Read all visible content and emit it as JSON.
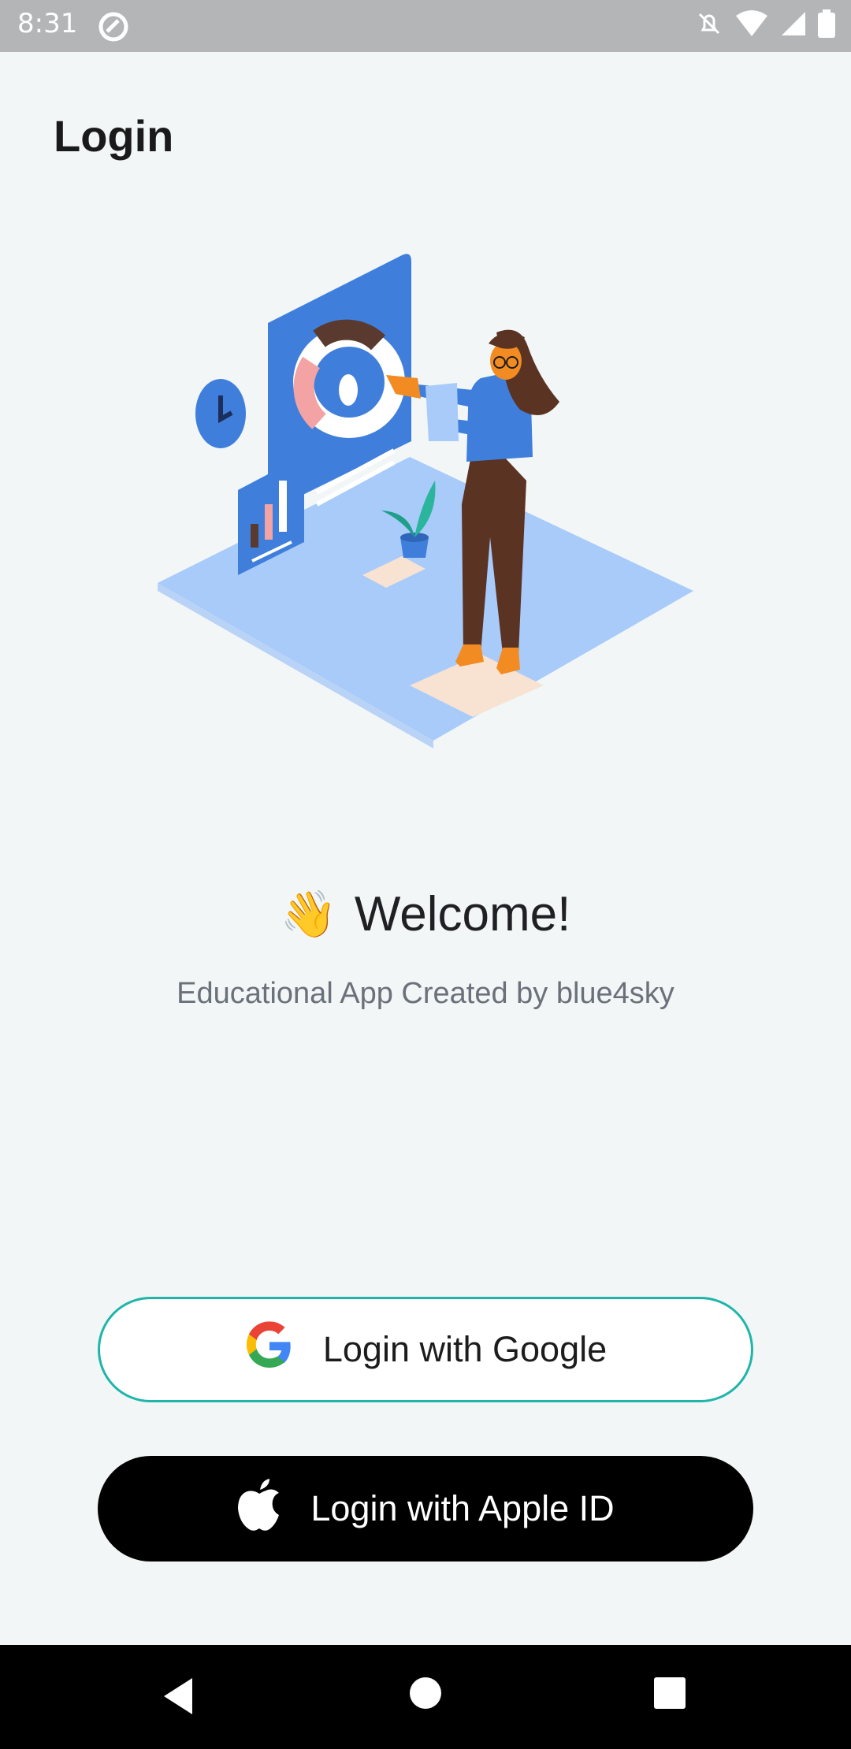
{
  "status_bar": {
    "time": "8:31",
    "icons": [
      "at-sign-icon",
      "bell-off-icon",
      "wifi-icon",
      "signal-icon",
      "battery-icon"
    ]
  },
  "header": {
    "title": "Login"
  },
  "hero": {
    "illustration": "woman-presenting-dashboard-illustration"
  },
  "welcome": {
    "emoji": "👋",
    "text": "Welcome!",
    "subtitle": "Educational App Created by blue4sky"
  },
  "buttons": {
    "google": {
      "label": "Login with Google",
      "icon": "google-icon",
      "border_color": "#1fb5aa"
    },
    "apple": {
      "label": "Login with Apple ID",
      "icon": "apple-icon"
    }
  },
  "nav_bar": {
    "icons": [
      "back-icon",
      "home-icon",
      "recents-icon"
    ]
  },
  "colors": {
    "background": "#f2f6f7",
    "accent_blue": "#3f7fdb",
    "light_blue": "#a8cbfa",
    "status_bar": "#b3b5b6"
  }
}
